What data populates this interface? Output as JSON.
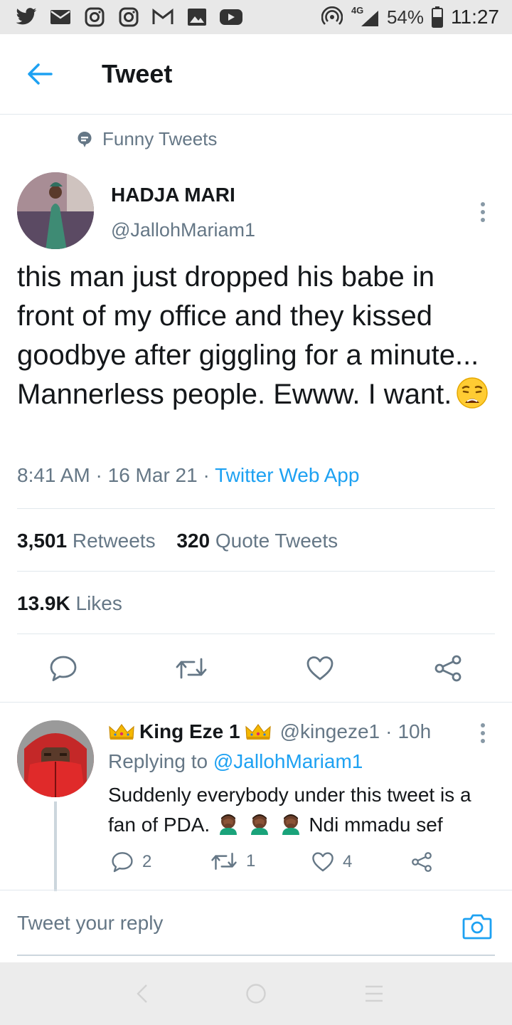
{
  "status_bar": {
    "battery": "54%",
    "time": "11:27",
    "network": "4G",
    "left_icons": [
      "twitter-icon",
      "mail-icon",
      "instagram-icon",
      "instagram-icon",
      "gmail-icon",
      "gallery-icon",
      "youtube-icon"
    ],
    "right_icons": [
      "hotspot-icon",
      "signal-icon",
      "battery-icon"
    ]
  },
  "header": {
    "title": "Tweet",
    "back_icon": "back-arrow-icon"
  },
  "context": {
    "label": "Funny Tweets"
  },
  "tweet": {
    "author_name": "HADJA MARI",
    "author_handle": "@JallohMariam1",
    "text": "this man just dropped his babe in front of my office and they kissed goodbye after giggling for a minute... Mannerless people. Ewww. I want.",
    "time": "8:41 AM",
    "date": "16 Mar 21",
    "source": "Twitter Web App",
    "retweets": "3,501",
    "retweets_label": "Retweets",
    "quotes": "320",
    "quotes_label": "Quote Tweets",
    "likes": "13.9K",
    "likes_label": "Likes"
  },
  "reply": {
    "name": "King Eze 1",
    "handle": "@kingeze1",
    "age": "10h",
    "replying_prefix": "Replying to",
    "replying_to": "@JallohMariam1",
    "text_start": "Suddenly everybody under this tweet is a fan of PDA.",
    "text_end": "Ndi mmadu sef",
    "replies": "2",
    "retweets": "1",
    "likes": "4"
  },
  "compose": {
    "placeholder": "Tweet your reply"
  },
  "colors": {
    "accent": "#1da1f2",
    "muted": "#657786",
    "text": "#14171a",
    "divider": "#e1e8ed"
  }
}
